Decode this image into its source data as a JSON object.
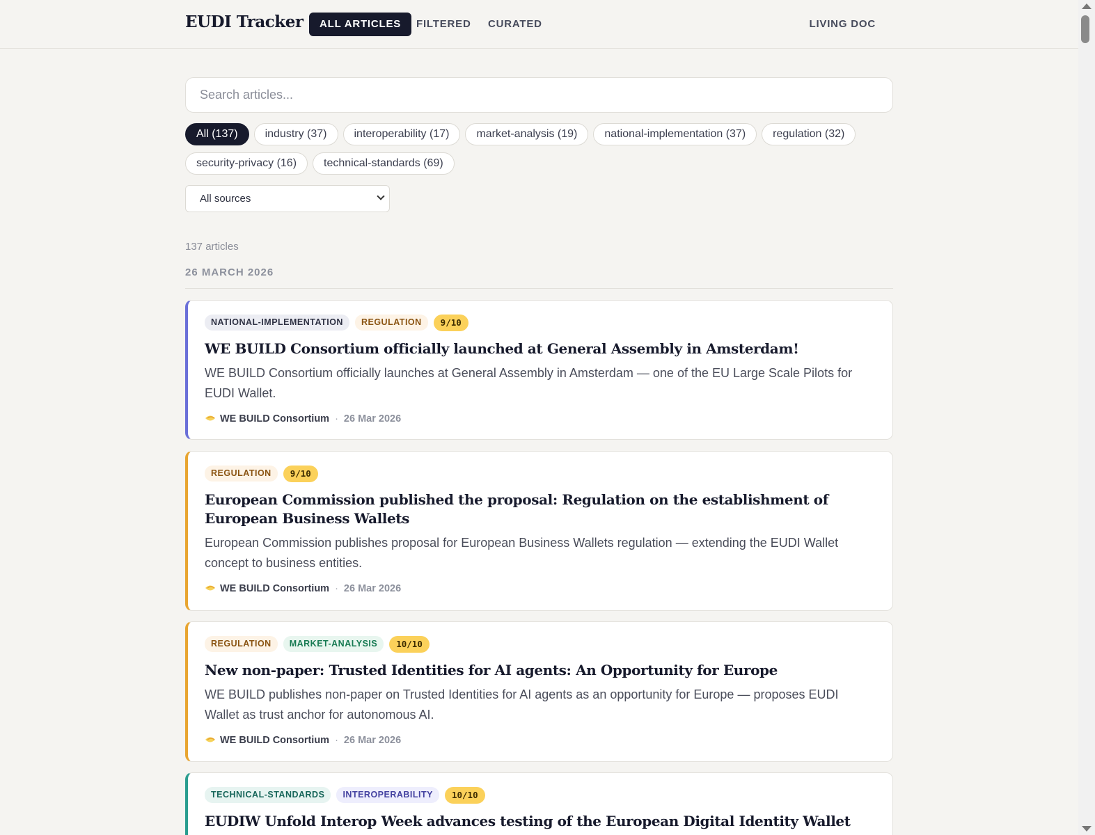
{
  "header": {
    "brand": "EUDI Tracker",
    "tabs": [
      {
        "label": "ALL ARTICLES",
        "active": true
      },
      {
        "label": "FILTERED",
        "active": false
      },
      {
        "label": "CURATED",
        "active": false
      }
    ],
    "living_doc": "LIVING DOC"
  },
  "search": {
    "placeholder": "Search articles..."
  },
  "filters": {
    "chips": [
      {
        "label": "All (137)",
        "active": true
      },
      {
        "label": "industry (37)",
        "active": false
      },
      {
        "label": "interoperability (17)",
        "active": false
      },
      {
        "label": "market-analysis (19)",
        "active": false
      },
      {
        "label": "national-implementation (37)",
        "active": false
      },
      {
        "label": "regulation (32)",
        "active": false
      },
      {
        "label": "security-privacy (16)",
        "active": false
      },
      {
        "label": "technical-standards (69)",
        "active": false
      }
    ],
    "source_select": "All sources"
  },
  "results": {
    "count_label": "137 articles",
    "date_heading": "26 MARCH 2026"
  },
  "articles": [
    {
      "tags": [
        "NATIONAL-IMPLEMENTATION",
        "REGULATION"
      ],
      "score": "9/10",
      "title": "WE BUILD Consortium officially launched at General Assembly in Amsterdam!",
      "summary": "WE BUILD Consortium officially launches at General Assembly in Amsterdam — one of the EU Large Scale Pilots for EUDI Wallet.",
      "source": "WE BUILD Consortium",
      "date": "26 Mar 2026",
      "accent": "#6a6fd8"
    },
    {
      "tags": [
        "REGULATION"
      ],
      "score": "9/10",
      "title": "European Commission published the proposal: Regulation on the establishment of European Business Wallets",
      "summary": "European Commission publishes proposal for European Business Wallets regulation — extending the EUDI Wallet concept to business entities.",
      "source": "WE BUILD Consortium",
      "date": "26 Mar 2026",
      "accent": "#e8a531"
    },
    {
      "tags": [
        "REGULATION",
        "MARKET-ANALYSIS"
      ],
      "score": "10/10",
      "title": "New non-paper: Trusted Identities for AI agents: An Opportunity for Europe",
      "summary": "WE BUILD publishes non-paper on Trusted Identities for AI agents as an opportunity for Europe — proposes EUDI Wallet as trust anchor for autonomous AI.",
      "source": "WE BUILD Consortium",
      "date": "26 Mar 2026",
      "accent": "#e8a531"
    },
    {
      "tags": [
        "TECHNICAL-STANDARDS",
        "INTEROPERABILITY"
      ],
      "score": "10/10",
      "title": "EUDIW Unfold Interop Week advances testing of the European Digital Identity Wallet ecosystem",
      "summary": "",
      "source": "",
      "date": "",
      "accent": "#2a9d8f"
    }
  ]
}
